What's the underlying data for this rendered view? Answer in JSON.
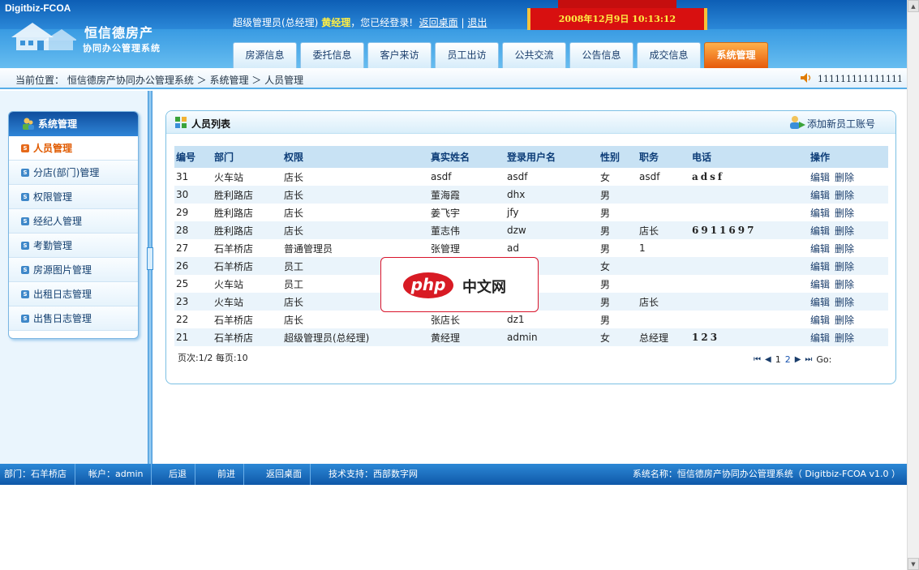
{
  "header": {
    "brand_code": "Digitbiz-FCOA",
    "company_name": "恒信德房产",
    "system_subtitle": "协同办公管理系统",
    "welcome_role": "超级管理员(总经理)",
    "welcome_user": "黄经理",
    "welcome_suffix": "，您已经登录!",
    "link_desktop": "返回桌面",
    "separator": "|",
    "link_logout": "退出",
    "datetime": "2008年12月9日  10:13:12"
  },
  "nav": {
    "tabs": [
      {
        "label": "房源信息"
      },
      {
        "label": "委托信息"
      },
      {
        "label": "客户来访"
      },
      {
        "label": "员工出访"
      },
      {
        "label": "公共交流"
      },
      {
        "label": "公告信息"
      },
      {
        "label": "成交信息"
      },
      {
        "label": "系统管理"
      }
    ],
    "active_index": 7
  },
  "breadcrumb": {
    "text": "当前位置： 恒信德房产协同办公管理系统 ＞ 系统管理 ＞ 人员管理",
    "notice": "111111111111111"
  },
  "sidebar": {
    "title": "系统管理",
    "items": [
      {
        "label": "人员管理"
      },
      {
        "label": "分店(部门)管理"
      },
      {
        "label": "权限管理"
      },
      {
        "label": "经纪人管理"
      },
      {
        "label": "考勤管理"
      },
      {
        "label": "房源图片管理"
      },
      {
        "label": "出租日志管理"
      },
      {
        "label": "出售日志管理"
      }
    ]
  },
  "panel": {
    "title": "人员列表",
    "add_link": "添加新员工账号",
    "columns": [
      "编号",
      "部门",
      "权限",
      "真实姓名",
      "登录用户名",
      "性别",
      "职务",
      "电话",
      "操作"
    ],
    "rows": [
      {
        "id": "31",
        "dept": "火车站",
        "role": "店长",
        "name": "asdf",
        "login": "asdf",
        "sex": "女",
        "title": "asdf",
        "phone": "adsf"
      },
      {
        "id": "30",
        "dept": "胜利路店",
        "role": "店长",
        "name": "董海霞",
        "login": "dhx",
        "sex": "男",
        "title": "",
        "phone": ""
      },
      {
        "id": "29",
        "dept": "胜利路店",
        "role": "店长",
        "name": "姜飞宇",
        "login": "jfy",
        "sex": "男",
        "title": "",
        "phone": ""
      },
      {
        "id": "28",
        "dept": "胜利路店",
        "role": "店长",
        "name": "董志伟",
        "login": "dzw",
        "sex": "男",
        "title": "店长",
        "phone": "6911697"
      },
      {
        "id": "27",
        "dept": "石羊桥店",
        "role": "普通管理员",
        "name": "张管理",
        "login": "ad",
        "sex": "男",
        "title": "1",
        "phone": ""
      },
      {
        "id": "26",
        "dept": "石羊桥店",
        "role": "员工",
        "name": "",
        "login": "",
        "sex": "女",
        "title": "",
        "phone": ""
      },
      {
        "id": "25",
        "dept": "火车站",
        "role": "员工",
        "name": "",
        "login": "",
        "sex": "男",
        "title": "",
        "phone": ""
      },
      {
        "id": "23",
        "dept": "火车站",
        "role": "店长",
        "name": "",
        "login": "",
        "sex": "男",
        "title": "店长",
        "phone": ""
      },
      {
        "id": "22",
        "dept": "石羊桥店",
        "role": "店长",
        "name": "张店长",
        "login": "dz1",
        "sex": "男",
        "title": "",
        "phone": ""
      },
      {
        "id": "21",
        "dept": "石羊桥店",
        "role": "超级管理员(总经理)",
        "name": "黄经理",
        "login": "admin",
        "sex": "女",
        "title": "总经理",
        "phone": "123"
      }
    ],
    "action_edit": "编辑",
    "action_delete": "删除",
    "page_info": "页次:1/2 每页:10",
    "pager": {
      "page1": "1",
      "page2": "2",
      "go": "Go:"
    }
  },
  "footer": {
    "dept": "部门：石羊桥店",
    "account": "帐户：admin",
    "back": "后退",
    "forward": "前进",
    "desktop": "返回桌面",
    "support": "技术支持：西部数字网",
    "system": "系统名称：恒信德房产协同办公管理系统（ Digitbiz-FCOA v1.0 ）"
  },
  "watermark": {
    "logo": "php",
    "text": "中文网"
  }
}
